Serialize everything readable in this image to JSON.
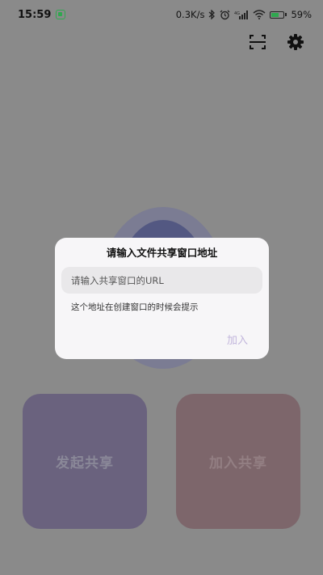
{
  "status_bar": {
    "time": "15:59",
    "network_speed": "0.3K/s",
    "signal_label": "4G",
    "battery_percent": "59%",
    "battery_level": 0.59,
    "icons": [
      "app-notification-icon",
      "bluetooth-icon",
      "alarm-icon",
      "signal-icon",
      "wifi-icon",
      "battery-icon"
    ]
  },
  "toolbar": {
    "icons": [
      "scan-icon",
      "settings-icon"
    ]
  },
  "actions": {
    "start_share": "发起共享",
    "join_share": "加入共享"
  },
  "dialog": {
    "title": "请输入文件共享窗口地址",
    "input_value": "",
    "input_placeholder": "请输入共享窗口的URL",
    "hint": "这个地址在创建窗口的时候会提示",
    "join_button": "加入"
  },
  "colors": {
    "overlay_background": "#8a8a8a",
    "start_card": "#6a627e",
    "join_card": "#7d666b",
    "dialog_background": "#f7f6f8",
    "join_button_text": "#c2b6dc"
  }
}
